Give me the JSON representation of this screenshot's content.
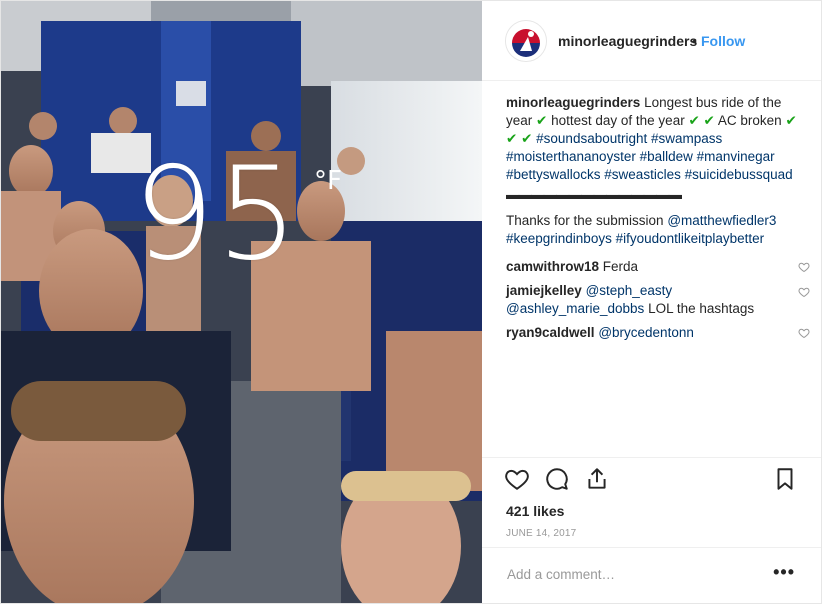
{
  "account": {
    "username": "minorleaguegrinders",
    "follow_label": "Follow",
    "separator": "•"
  },
  "photo": {
    "temperature": "95",
    "unit": "°F"
  },
  "caption": {
    "username": "minorleaguegrinders",
    "line1_a": "Longest bus ride of the year",
    "check": "✔",
    "line1_b": "hottest day of the year",
    "line1_c": "AC broken",
    "hashtags_1": "#soundsaboutright",
    "hashtags_2": "#swampass #moisterthananoyster #balldew",
    "hashtags_3": "#manvinegar #bettyswallocks #sweasticles",
    "hashtags_4": "#suicidebussquad",
    "dashes": "▬▬▬▬▬▬▬▬▬▬▬▬▬▬",
    "thanks": "Thanks for the submission",
    "thanks_mention": "@matthewfiedler3",
    "thanks_tags": "#keepgrindinboys #ifyoudontlikeitplaybetter"
  },
  "comments": [
    {
      "user": "camwithrow18",
      "text": "Ferda"
    },
    {
      "user": "jamiejkelley",
      "mention": "@steph_easty @ashley_marie_dobbs",
      "text": "LOL the hashtags"
    },
    {
      "user": "ryan9caldwell",
      "mention": "@brycedentonn",
      "text": ""
    }
  ],
  "actions": {
    "likes": "421 likes",
    "date": "JUNE 14, 2017"
  },
  "add_comment": {
    "placeholder": "Add a comment…",
    "more": "•••"
  },
  "icons": [
    "heart-icon",
    "comment-icon",
    "share-icon",
    "bookmark-icon",
    "more-icon"
  ]
}
